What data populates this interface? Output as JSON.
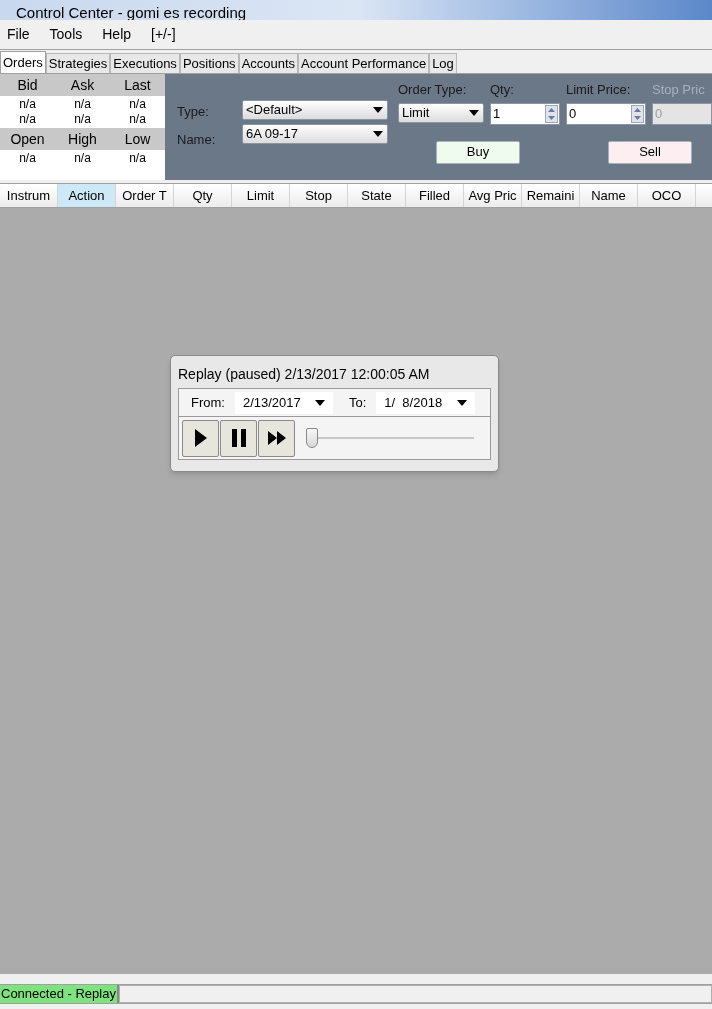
{
  "window": {
    "title": "Control Center - gomi es recording"
  },
  "menu": [
    "File",
    "Tools",
    "Help",
    "[+/-]"
  ],
  "tabs": [
    {
      "label": "Orders",
      "selected": true
    },
    {
      "label": "Strategies",
      "selected": false
    },
    {
      "label": "Executions",
      "selected": false
    },
    {
      "label": "Positions",
      "selected": false
    },
    {
      "label": "Accounts",
      "selected": false
    },
    {
      "label": "Account Performance",
      "selected": false
    },
    {
      "label": "Log",
      "selected": false
    }
  ],
  "quote": {
    "top_headers": [
      "Bid",
      "Ask",
      "Last"
    ],
    "top_rows": [
      [
        "n/a",
        "n/a",
        "n/a"
      ],
      [
        "n/a",
        "n/a",
        "n/a"
      ]
    ],
    "bottom_headers": [
      "Open",
      "High",
      "Low"
    ],
    "bottom_rows": [
      [
        "n/a",
        "n/a",
        "n/a"
      ]
    ]
  },
  "order_entry": {
    "type_label": "Type:",
    "type_value": "<Default>",
    "name_label": "Name:",
    "name_value": "6A 09-17",
    "fields": [
      {
        "kind": "dropdown",
        "label": "Order Type:",
        "value": "Limit",
        "disabled": false
      },
      {
        "kind": "spinner",
        "label": "Qty:",
        "value": "1",
        "disabled": false
      },
      {
        "kind": "spinner",
        "label": "Limit Price:",
        "value": "0",
        "disabled": false
      },
      {
        "kind": "text",
        "label": "Stop Pric",
        "value": "0",
        "disabled": true
      }
    ],
    "buy": "Buy",
    "sell": "Sell"
  },
  "columns": [
    {
      "label": "Instrum",
      "selected": false
    },
    {
      "label": "Action",
      "selected": true
    },
    {
      "label": "Order T",
      "selected": false
    },
    {
      "label": "Qty",
      "selected": false
    },
    {
      "label": "Limit",
      "selected": false
    },
    {
      "label": "Stop",
      "selected": false
    },
    {
      "label": "State",
      "selected": false
    },
    {
      "label": "Filled",
      "selected": false
    },
    {
      "label": "Avg Pric",
      "selected": false
    },
    {
      "label": "Remaini",
      "selected": false
    },
    {
      "label": "Name",
      "selected": false
    },
    {
      "label": "OCO",
      "selected": false
    }
  ],
  "replay": {
    "title": "Replay (paused) 2/13/2017 12:00:05 AM",
    "from_label": "From:",
    "from_value": "2/13/2017",
    "to_label": "To:",
    "to_value": "1/  8/2018",
    "level": 0
  },
  "status_bar": {
    "connection": "Connected - Replay"
  }
}
